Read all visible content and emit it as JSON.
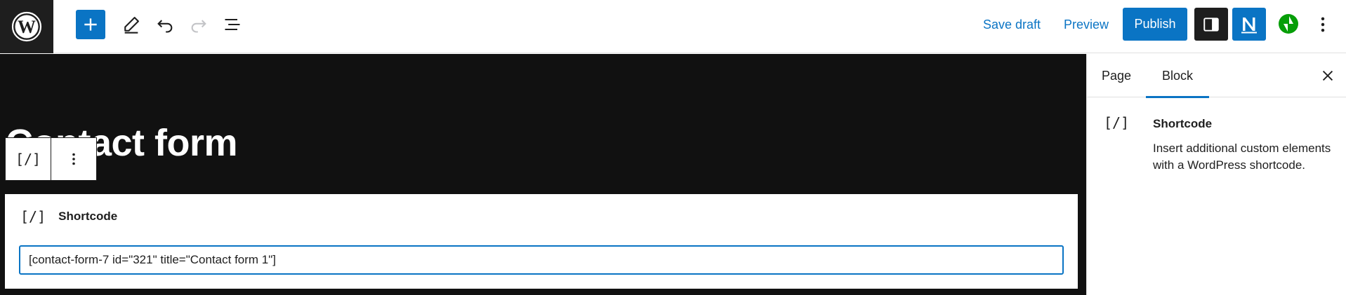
{
  "toolbar": {
    "save_draft_label": "Save draft",
    "preview_label": "Preview",
    "publish_label": "Publish"
  },
  "icons": {
    "logo": "wordpress-logo-icon",
    "add": "plus-icon",
    "tools": "pencil-icon",
    "undo": "undo-icon",
    "redo": "redo-icon",
    "outline": "list-view-icon",
    "settings": "sidebar-toggle-icon",
    "plugin": "n-logo-icon",
    "jetpack": "jetpack-bolt-icon",
    "more": "vertical-ellipsis-icon",
    "close": "close-icon",
    "shortcode": "shortcode-icon"
  },
  "colors": {
    "accent": "#0a74c4",
    "canvas_bg": "#111111",
    "dark": "#1e1e1e",
    "jetpack_green": "#069e08"
  },
  "canvas": {
    "page_title": "Contact form",
    "block_toolbar": {
      "type_glyph": "[/]"
    },
    "shortcode_block": {
      "glyph": "[/]",
      "label": "Shortcode",
      "input_value": "[contact-form-7 id=\"321\" title=\"Contact form 1\"]"
    }
  },
  "sidebar": {
    "tabs": [
      {
        "label": "Page",
        "active": false
      },
      {
        "label": "Block",
        "active": true
      }
    ],
    "block": {
      "glyph": "[/]",
      "title": "Shortcode",
      "description": "Insert additional custom elements with a WordPress shortcode."
    }
  }
}
